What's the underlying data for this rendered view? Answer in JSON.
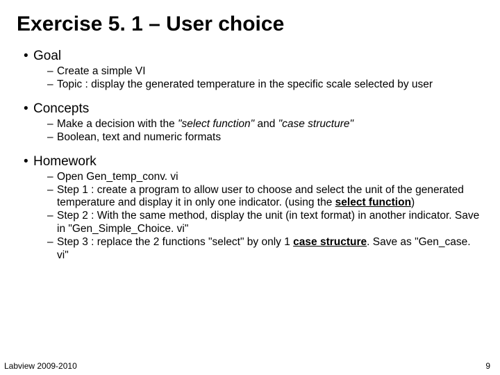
{
  "title": "Exercise 5. 1 – User choice",
  "sections": {
    "goal": {
      "heading": "Goal",
      "items": {
        "a": "Create a simple VI",
        "b": "Topic : display the generated temperature in the specific scale selected by user"
      }
    },
    "concepts": {
      "heading": "Concepts",
      "items": {
        "a_pre": "Make a decision with the ",
        "a_it1": "\"select function\"",
        "a_mid": " and ",
        "a_it2": "\"case structure\"",
        "b": "Boolean, text and numeric formats"
      }
    },
    "homework": {
      "heading": "Homework",
      "items": {
        "a": "Open Gen_temp_conv. vi",
        "b_pre": "Step 1 : create a program to allow user to choose and select the unit of the generated temperature and display it in only one indicator. (using the ",
        "b_ul": "select function",
        "b_post": ")",
        "c": "Step 2 : With the same method, display the unit (in text format) in another indicator. Save in \"Gen_Simple_Choice. vi\"",
        "d_pre": "Step 3 : replace the 2 functions \"select\" by only 1 ",
        "d_ul": "case structure",
        "d_post": ". Save as \"Gen_case. vi\""
      }
    }
  },
  "footer": {
    "left": "Labview 2009-2010",
    "right": "9"
  }
}
